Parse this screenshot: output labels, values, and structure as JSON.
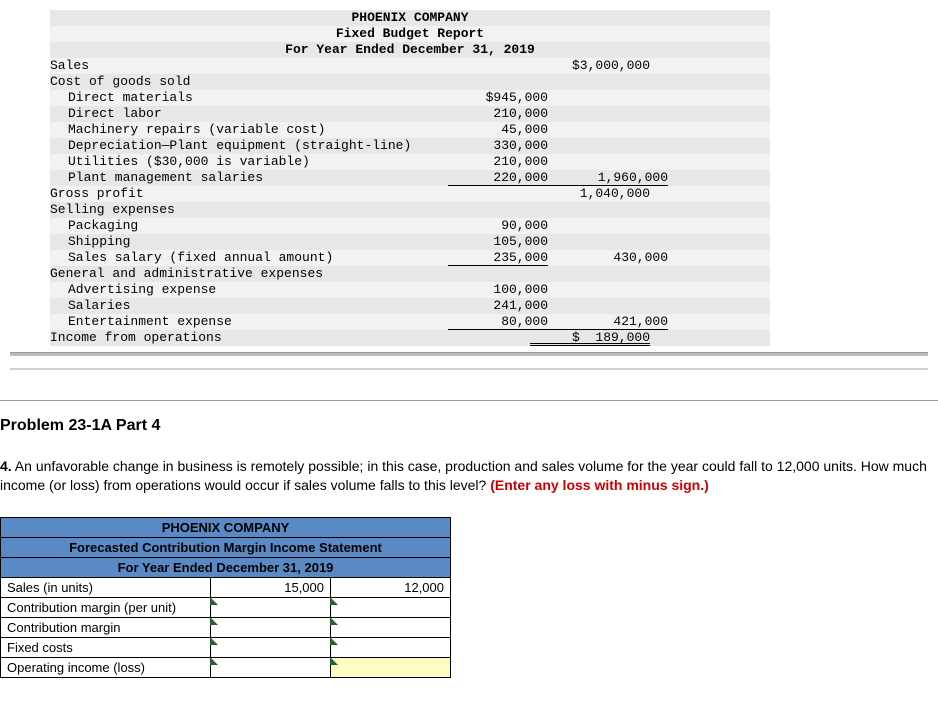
{
  "report": {
    "company": "PHOENIX COMPANY",
    "title": "Fixed Budget Report",
    "period": "For Year Ended December 31, 2019",
    "sales_label": "Sales",
    "sales_value": "$3,000,000",
    "cogs_label": "Cost of goods sold",
    "cogs": [
      {
        "label": "Direct materials",
        "v1": "$945,000"
      },
      {
        "label": "Direct labor",
        "v1": "210,000"
      },
      {
        "label": "Machinery repairs (variable cost)",
        "v1": "45,000"
      },
      {
        "label": "Depreciation—Plant equipment (straight-line)",
        "v1": "330,000"
      },
      {
        "label": "Utilities ($30,000 is variable)",
        "v1": "210,000"
      },
      {
        "label": "Plant management salaries",
        "v1": "220,000",
        "v2": "1,960,000"
      }
    ],
    "gross_profit_label": "Gross profit",
    "gross_profit_value": "1,040,000",
    "selling_label": "Selling expenses",
    "selling": [
      {
        "label": "Packaging",
        "v1": "90,000"
      },
      {
        "label": "Shipping",
        "v1": "105,000"
      },
      {
        "label": "Sales salary (fixed annual amount)",
        "v1": "235,000",
        "v2": "430,000"
      }
    ],
    "ga_label": "General and administrative expenses",
    "ga": [
      {
        "label": "Advertising expense",
        "v1": "100,000"
      },
      {
        "label": "Salaries",
        "v1": "241,000"
      },
      {
        "label": "Entertainment expense",
        "v1": "80,000",
        "v2": "421,000"
      }
    ],
    "income_label": "Income from operations",
    "income_value": "$  189,000"
  },
  "problem": {
    "heading": "Problem 23-1A Part 4",
    "num": "4.",
    "text": " An unfavorable change in business is remotely possible; in this case, production and sales volume for the year could fall to 12,000 units. How much income (or loss) from operations would occur if sales volume falls to this level? ",
    "instruction": "(Enter any loss with minus sign.)"
  },
  "cm": {
    "company": "PHOENIX COMPANY",
    "title": "Forecasted Contribution Margin Income Statement",
    "period": "For Year Ended December 31, 2019",
    "rows": {
      "r0": {
        "label": "Sales (in units)",
        "c1": "15,000",
        "c2": "12,000"
      },
      "r1": {
        "label": "Contribution margin (per unit)"
      },
      "r2": {
        "label": "Contribution margin"
      },
      "r3": {
        "label": "Fixed costs"
      },
      "r4": {
        "label": "Operating income (loss)"
      }
    }
  }
}
